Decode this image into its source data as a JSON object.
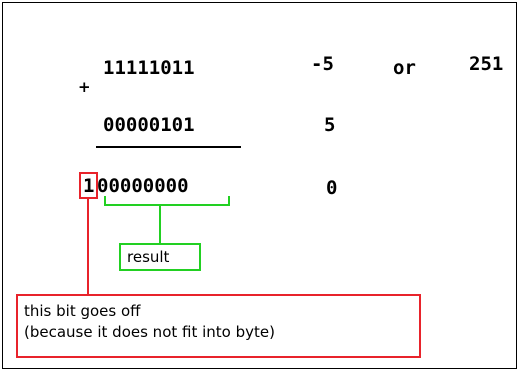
{
  "rows": {
    "first": {
      "binary": "11111011",
      "signed": "-5",
      "or": "or",
      "unsigned": "251"
    },
    "operator": "+",
    "second": {
      "binary": "00000101",
      "signed": "5"
    },
    "sum": {
      "carry_bit": "1",
      "binary": "00000000",
      "signed": "0"
    }
  },
  "labels": {
    "result": "result",
    "note_line1": "this bit goes off",
    "note_line2": "(because it does not fit into byte)"
  },
  "colors": {
    "carry_highlight": "#e8232b",
    "result_highlight": "#22d022",
    "text": "#000000"
  }
}
